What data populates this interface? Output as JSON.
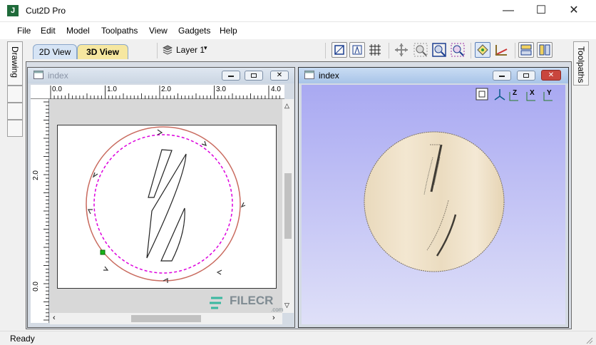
{
  "window": {
    "title": "Cut2D Pro",
    "icon_letter": "J"
  },
  "menu": [
    "File",
    "Edit",
    "Model",
    "Toolpaths",
    "View",
    "Gadgets",
    "Help"
  ],
  "view_tabs": {
    "tab_2d": "2D View",
    "tab_3d": "3D View"
  },
  "layer": {
    "label": "Layer 1"
  },
  "side_tabs": {
    "left": "Drawing",
    "right": "Toolpaths"
  },
  "left_view": {
    "title": "index",
    "ruler_top": [
      "0.0",
      "1.0",
      "2.0",
      "3.0",
      "4.0"
    ],
    "ruler_left": [
      "2.0",
      "0.0"
    ]
  },
  "right_view": {
    "title": "index",
    "view_buttons": [
      {
        "icon": "fit-view-icon",
        "label": ""
      },
      {
        "icon": "iso-view-icon",
        "label": ""
      },
      {
        "icon": "axis-z-icon",
        "label": "Z"
      },
      {
        "icon": "axis-x-icon",
        "label": "X"
      },
      {
        "icon": "axis-y-icon",
        "label": "Y"
      }
    ]
  },
  "watermark": {
    "text": "FILECR",
    "sub": ".com"
  },
  "status": {
    "text": "Ready"
  },
  "colors": {
    "accent_tab_3d": "#f6e7a0",
    "tab_2d": "#d6e4f5",
    "bg_3d_top": "#a9a9f2",
    "bg_3d_bottom": "#dfe0f8",
    "wood": "#efe2c8",
    "toolpath_red": "#c96b5f",
    "offset_magenta": "#dd00dd"
  }
}
